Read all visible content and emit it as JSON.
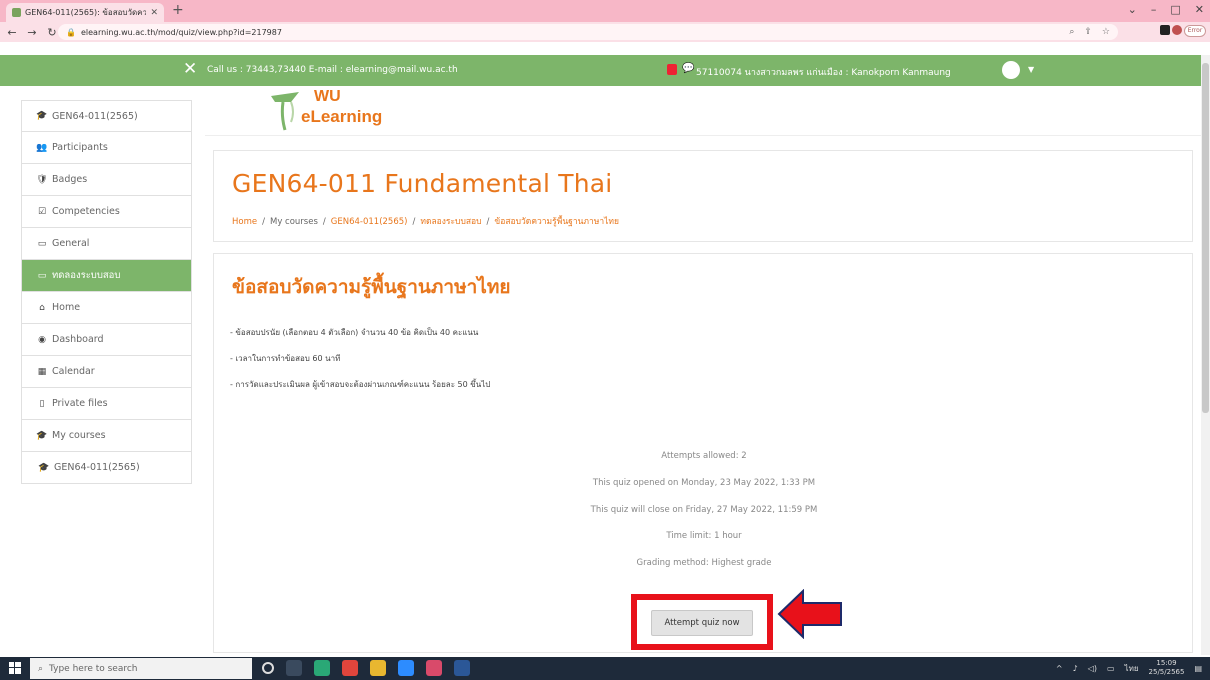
{
  "browser": {
    "tab_title": "GEN64-011(2565): ข้อสอบวัดความ...",
    "url": "elearning.wu.ac.th/mod/quiz/view.php?id=217987",
    "error_label": "Error"
  },
  "header": {
    "contact": "Call us : 73443,73440  E-mail : elearning@mail.wu.ac.th",
    "user": "57110074 นางสาวกมลพร แก่นเมือง : Kanokporn Kanmaung"
  },
  "logo": {
    "line1": "WU",
    "line2": "eLearning"
  },
  "sidebar": {
    "items": [
      {
        "label": "GEN64-011(2565)",
        "icon": "graduation-cap-icon",
        "glyph": "🎓"
      },
      {
        "label": "Participants",
        "icon": "users-icon",
        "glyph": "👥"
      },
      {
        "label": "Badges",
        "icon": "shield-icon",
        "glyph": "🛡"
      },
      {
        "label": "Competencies",
        "icon": "checkbox-icon",
        "glyph": "☑"
      },
      {
        "label": "General",
        "icon": "folder-icon",
        "glyph": "▭"
      },
      {
        "label": "ทดลองระบบสอบ",
        "icon": "folder-icon",
        "glyph": "▭"
      },
      {
        "label": "Home",
        "icon": "home-icon",
        "glyph": "⌂"
      },
      {
        "label": "Dashboard",
        "icon": "dashboard-icon",
        "glyph": "◉"
      },
      {
        "label": "Calendar",
        "icon": "calendar-icon",
        "glyph": "▦"
      },
      {
        "label": "Private files",
        "icon": "file-icon",
        "glyph": "▯"
      },
      {
        "label": "My courses",
        "icon": "graduation-cap-icon",
        "glyph": "🎓"
      },
      {
        "label": "GEN64-011(2565)",
        "icon": "graduation-cap-icon",
        "glyph": "🎓"
      }
    ]
  },
  "course": {
    "title": "GEN64-011 Fundamental Thai",
    "breadcrumb": [
      "Home",
      "My courses",
      "GEN64-011(2565)",
      "ทดลองระบบสอบ",
      "ข้อสอบวัดความรู้พื้นฐานภาษาไทย"
    ]
  },
  "quiz": {
    "title": "ข้อสอบวัดความรู้พื้นฐานภาษาไทย",
    "intro": [
      "- ข้อสอบปรนัย (เลือกตอบ 4 ตัวเลือก) จำนวน 40 ข้อ คิดเป็น 40 คะแนน",
      "- เวลาในการทำข้อสอบ 60 นาที",
      "- การวัดและประเมินผล ผู้เข้าสอบจะต้องผ่านเกณฑ์คะแนน ร้อยละ 50 ขึ้นไป"
    ],
    "attempts": "Attempts allowed: 2",
    "opened": "This quiz opened on Monday, 23 May 2022, 1:33 PM",
    "close": "This quiz will close on Friday, 27 May 2022, 11:59 PM",
    "time_limit": "Time limit: 1 hour",
    "grading": "Grading method: Highest grade",
    "attempt_button": "Attempt quiz now"
  },
  "taskbar": {
    "search_placeholder": "Type here to search",
    "time": "15:09",
    "date": "25/5/2565",
    "lang": "ไทย"
  },
  "colors": {
    "accent_orange": "#e8761c",
    "header_green": "#7db56a",
    "highlight_red": "#e8111a"
  }
}
